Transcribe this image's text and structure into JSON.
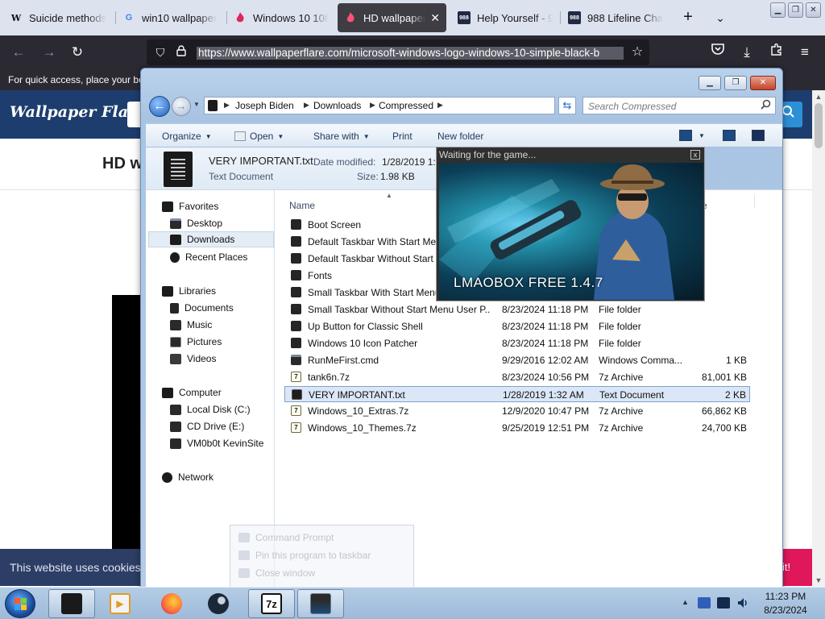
{
  "browser": {
    "tabs": [
      {
        "label": "Suicide methods",
        "favicon": "W",
        "active": false
      },
      {
        "label": "win10 wallpaper",
        "favicon": "G",
        "active": false
      },
      {
        "label": "Windows 10 1080",
        "favicon": "flame",
        "active": false
      },
      {
        "label": "HD wallpaper: Mi",
        "favicon": "flame",
        "active": true
      },
      {
        "label": "Help Yourself - 98",
        "favicon": "988",
        "active": false
      },
      {
        "label": "988 Lifeline Chat a",
        "favicon": "988",
        "active": false
      }
    ],
    "new_tab_glyph": "+",
    "tab_list_glyph": "⌄",
    "url": "https://www.wallpaperflare.com/microsoft-windows-logo-windows-10-simple-black-b",
    "bookmarks_hint": "For quick access, place your bo",
    "window_controls": {
      "minimize": "▁",
      "restore": "❐",
      "close": "✕"
    }
  },
  "website": {
    "logo": "Wallpaper Flare",
    "heading_fragment": "HD w",
    "cookie_text": "This website uses cookies t",
    "cookie_button_fragment": "it!"
  },
  "explorer": {
    "breadcrumbs": [
      "Joseph Biden",
      "Downloads",
      "Compressed"
    ],
    "search_placeholder": "Search Compressed",
    "commands": {
      "organize": "Organize",
      "open": "Open",
      "share_with": "Share with",
      "print": "Print",
      "new_folder": "New folder"
    },
    "details": {
      "name": "VERY IMPORTANT.txt",
      "type": "Text Document",
      "date_label": "Date modified:",
      "date_value": "1/28/2019 1:3",
      "size_label": "Size:",
      "size_value": "1.98 KB"
    },
    "nav": [
      {
        "label": "Favorites",
        "icon": "favorites-icon",
        "level": 0
      },
      {
        "label": "Desktop",
        "icon": "desktop-icon",
        "level": 1
      },
      {
        "label": "Downloads",
        "icon": "downloads-icon",
        "level": 1,
        "selected": true
      },
      {
        "label": "Recent Places",
        "icon": "recent-places-icon",
        "level": 1
      },
      {
        "label": "Libraries",
        "icon": "libraries-icon",
        "level": 0
      },
      {
        "label": "Documents",
        "icon": "documents-icon",
        "level": 1
      },
      {
        "label": "Music",
        "icon": "music-icon",
        "level": 1
      },
      {
        "label": "Pictures",
        "icon": "pictures-icon",
        "level": 1
      },
      {
        "label": "Videos",
        "icon": "videos-icon",
        "level": 1
      },
      {
        "label": "Computer",
        "icon": "computer-icon",
        "level": 0
      },
      {
        "label": "Local Disk (C:)",
        "icon": "drive-icon",
        "level": 1
      },
      {
        "label": "CD Drive (E:)",
        "icon": "cd-drive-icon",
        "level": 1
      },
      {
        "label": "VM0b0t KevinSite",
        "icon": "network-drive-icon",
        "level": 1
      },
      {
        "label": "Network",
        "icon": "network-icon",
        "level": 0
      }
    ],
    "columns": {
      "name": "Name",
      "size_fragment": "e"
    },
    "files": [
      {
        "name": "Boot Screen",
        "date": "",
        "type": "",
        "size": "",
        "icon": "folder"
      },
      {
        "name": "Default Taskbar With Start Men",
        "date": "",
        "type": "",
        "size": "",
        "icon": "folder"
      },
      {
        "name": "Default Taskbar Without Start M",
        "date": "",
        "type": "",
        "size": "",
        "icon": "folder"
      },
      {
        "name": "Fonts",
        "date": "",
        "type": "",
        "size": "",
        "icon": "folder"
      },
      {
        "name": "Small Taskbar With Start Menu",
        "date": "",
        "type": "",
        "size": "",
        "icon": "folder"
      },
      {
        "name": "Small Taskbar Without Start Menu User P...",
        "date": "8/23/2024 11:18 PM",
        "type": "File folder",
        "size": "",
        "icon": "folder"
      },
      {
        "name": "Up Button for Classic Shell",
        "date": "8/23/2024 11:18 PM",
        "type": "File folder",
        "size": "",
        "icon": "folder"
      },
      {
        "name": "Windows 10 Icon Patcher",
        "date": "8/23/2024 11:18 PM",
        "type": "File folder",
        "size": "",
        "icon": "folder"
      },
      {
        "name": "RunMeFirst.cmd",
        "date": "9/29/2016 12:02 AM",
        "type": "Windows Comma...",
        "size": "1 KB",
        "icon": "cmd"
      },
      {
        "name": "tank6n.7z",
        "date": "8/23/2024 10:56 PM",
        "type": "7z Archive",
        "size": "81,001 KB",
        "icon": "7z"
      },
      {
        "name": "VERY IMPORTANT.txt",
        "date": "1/28/2019 1:32 AM",
        "type": "Text Document",
        "size": "2 KB",
        "icon": "txt",
        "selected": true
      },
      {
        "name": "Windows_10_Extras.7z",
        "date": "12/9/2020 10:47 PM",
        "type": "7z Archive",
        "size": "66,862 KB",
        "icon": "7z"
      },
      {
        "name": "Windows_10_Themes.7z",
        "date": "9/25/2019 12:51 PM",
        "type": "7z Archive",
        "size": "24,700 KB",
        "icon": "7z"
      }
    ]
  },
  "popup": {
    "title": "Waiting for the game...",
    "product": "LMAOBOX FREE 1.4.7",
    "close_glyph": "x"
  },
  "jumplist": {
    "items": [
      "Command Prompt",
      "Pin this program to taskbar",
      "Close window"
    ]
  },
  "taskbar": {
    "apps": [
      {
        "name": "explorer",
        "running": true
      },
      {
        "name": "media-player",
        "running": false
      },
      {
        "name": "firefox",
        "running": false
      },
      {
        "name": "steam",
        "running": false
      },
      {
        "name": "7zip",
        "running": true,
        "glyph": "7z"
      },
      {
        "name": "command-prompt",
        "running": true
      }
    ],
    "clock": {
      "time": "11:23 PM",
      "date": "8/23/2024"
    }
  },
  "colors": {
    "browser_tabbar": "#dde3ee",
    "browser_toolbar": "#2b2a33",
    "site_header": "#1d3d6e",
    "explorer_frame": "#b9d1ea",
    "selection": "#dbe7f7",
    "taskbar": "#a8c2df"
  }
}
